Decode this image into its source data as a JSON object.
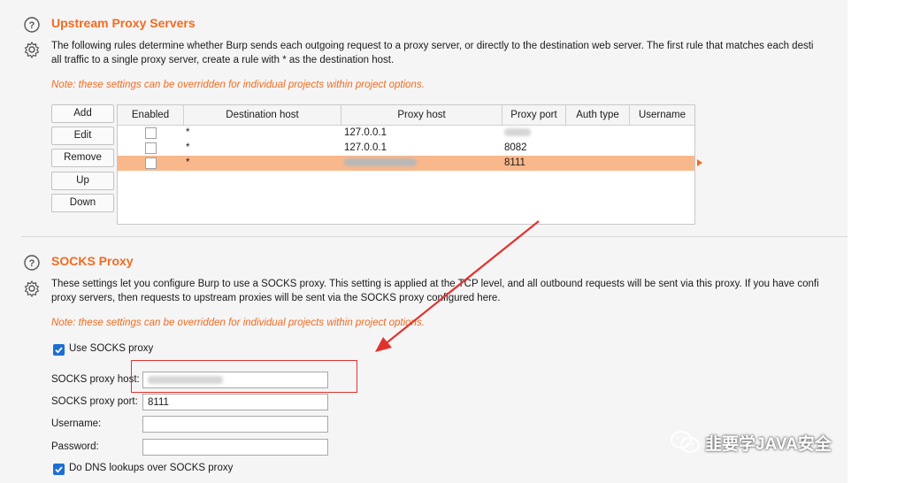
{
  "upstream": {
    "title": "Upstream Proxy Servers",
    "description_line1": "The following rules determine whether Burp sends each outgoing request to a proxy server, or directly to the destination web server. The first rule that matches each desti",
    "description_line2": "all traffic to a single proxy server, create a rule with * as the destination host.",
    "note": "Note: these settings can be overridden for individual projects within project options.",
    "buttons": {
      "add": "Add",
      "edit": "Edit",
      "remove": "Remove",
      "up": "Up",
      "down": "Down"
    },
    "table": {
      "columns": [
        "Enabled",
        "Destination host",
        "Proxy host",
        "Proxy port",
        "Auth type",
        "Username"
      ],
      "rows": [
        {
          "enabled": false,
          "destination_host": "*",
          "proxy_host": "127.0.0.1",
          "proxy_port": "",
          "auth_type": "",
          "username": "",
          "selected": false
        },
        {
          "enabled": false,
          "destination_host": "*",
          "proxy_host": "127.0.0.1",
          "proxy_port": "8082",
          "auth_type": "",
          "username": "",
          "selected": false
        },
        {
          "enabled": false,
          "destination_host": "*",
          "proxy_host": "",
          "proxy_port": "8111",
          "auth_type": "",
          "username": "",
          "selected": true
        }
      ]
    }
  },
  "socks": {
    "title": "SOCKS Proxy",
    "description_line1": "These settings let you configure Burp to use a SOCKS proxy. This setting is applied at the TCP level, and all outbound requests will be sent via this proxy. If you have confi",
    "description_line2": "proxy servers, then requests to upstream proxies will be sent via the SOCKS proxy configured here.",
    "note": "Note: these settings can be overridden for individual projects within project options.",
    "use_socks": {
      "label": "Use SOCKS proxy",
      "checked": true
    },
    "fields": {
      "host_label": "SOCKS proxy host:",
      "host_value": "",
      "port_label": "SOCKS proxy port:",
      "port_value": "8111",
      "username_label": "Username:",
      "username_value": "",
      "password_label": "Password:",
      "password_value": ""
    },
    "dns": {
      "label": "Do DNS lookups over SOCKS proxy",
      "checked": true
    }
  },
  "watermark": {
    "text": "韭要学JAVA安全"
  },
  "colors": {
    "accent": "#f26b21",
    "selected_row": "#f9b88c",
    "checkbox": "#1e6fd1",
    "annotation": "#e0332e"
  },
  "icons": [
    "help-icon",
    "gear-icon",
    "checkmark-icon",
    "wechat-icon"
  ]
}
